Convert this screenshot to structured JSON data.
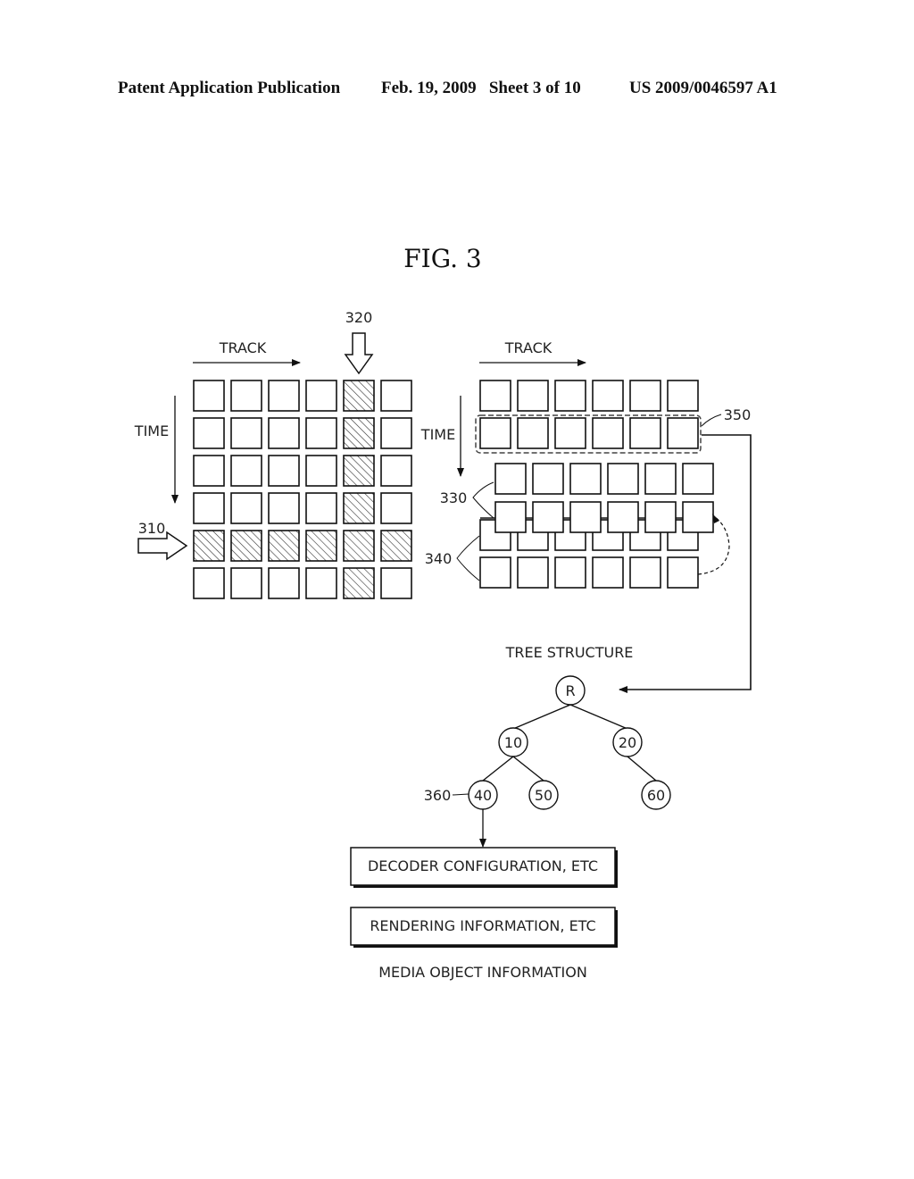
{
  "header": {
    "publication": "Patent Application Publication",
    "date_sheet": "Feb. 19, 2009   Sheet 3 of 10",
    "number": "US 2009/0046597 A1"
  },
  "figure": {
    "title": "FIG.  3",
    "left_grid": {
      "track_label": "TRACK",
      "time_label": "TIME",
      "rows": 6,
      "cols": 6,
      "highlight_row_index": 4,
      "highlight_col_index": 4,
      "row_ref": "310",
      "col_ref": "320"
    },
    "right_grid": {
      "track_label": "TRACK",
      "time_label": "TIME",
      "cols": 6,
      "selected_row_ref": "350",
      "ref_330": "330",
      "ref_340": "340"
    },
    "tree": {
      "title": "TREE STRUCTURE",
      "root": "R",
      "level1": [
        "10",
        "20"
      ],
      "level2": [
        "40",
        "50",
        "60"
      ],
      "node_ref": "360"
    },
    "media_object": {
      "boxes": [
        "DECODER CONFIGURATION, ETC",
        "RENDERING INFORMATION, ETC"
      ],
      "caption": "MEDIA OBJECT INFORMATION"
    }
  }
}
